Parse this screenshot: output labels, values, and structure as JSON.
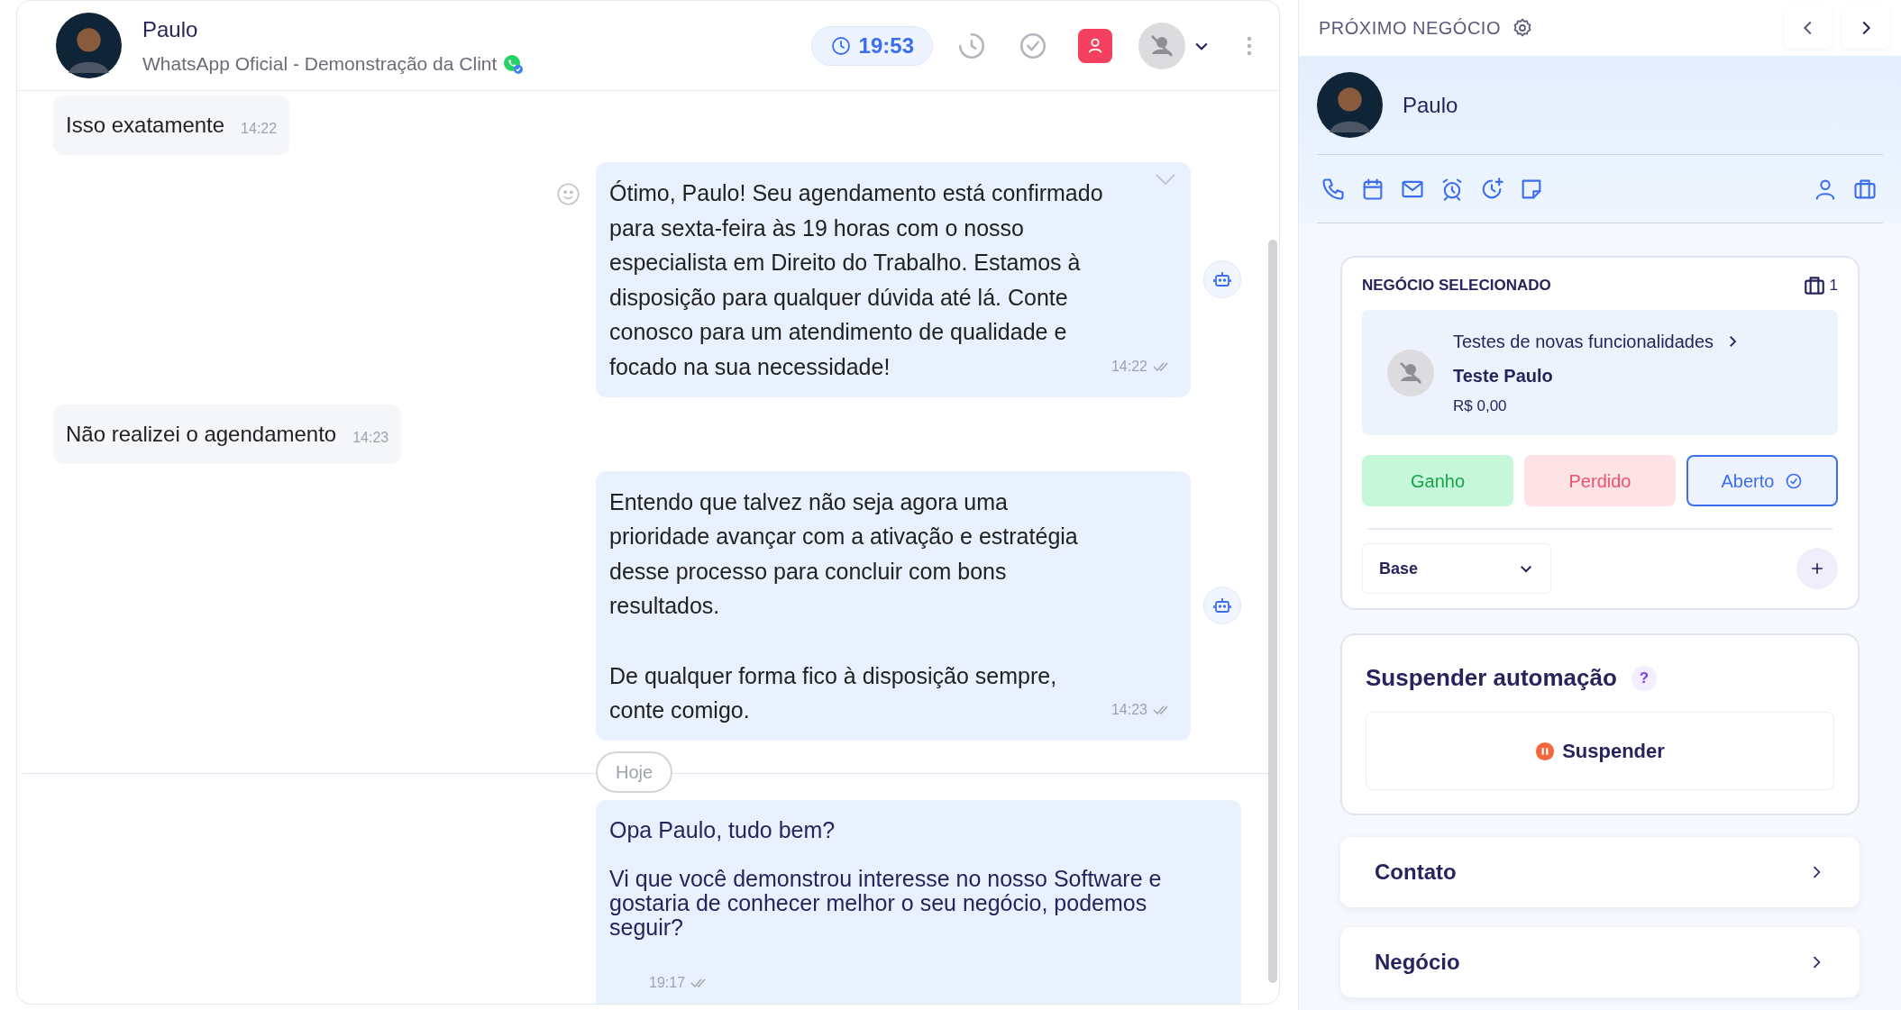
{
  "chat": {
    "contact": {
      "name": "Paulo",
      "channel": "WhatsApp Oficial - Demonstração da Clint"
    },
    "timer": "19:53",
    "messages": [
      {
        "kind": "incoming",
        "text": "Isso exatamente",
        "time": "14:22"
      },
      {
        "kind": "outgoing",
        "text": "Ótimo, Paulo! Seu agendamento está confirmado para sexta-feira às 19 horas com o nosso especialista em Direito do Trabalho. Estamos à disposição para qualquer dúvida até lá. Conte conosco para um atendimento de qualidade e focado na sua necessidade!",
        "time": "14:22",
        "automated": true,
        "hovered": true
      },
      {
        "kind": "incoming",
        "text": "Não realizei o agendamento",
        "time": "14:23"
      },
      {
        "kind": "outgoing",
        "text": "Entendo que talvez não seja agora uma prioridade avançar com a ativação e estratégia desse processo para concluir com bons resultados.\n\nDe qualquer forma fico à disposição sempre, conte comigo.",
        "time": "14:23",
        "automated": true,
        "hovered": false
      },
      {
        "kind": "date",
        "text": "Hoje"
      },
      {
        "kind": "outgoing",
        "text": "Opa Paulo, tudo bem?\n\nVi que você demonstrou interesse no nosso Software e gostaria de conhecer melhor o seu negócio, podemos seguir?",
        "time": "19:17",
        "automated": false,
        "hovered": false
      }
    ]
  },
  "side_panel": {
    "title": "PRÓXIMO NEGÓCIO",
    "contact_name": "Paulo",
    "selected_deal": {
      "title": "NEGÓCIO SELECIONADO",
      "count": "1",
      "pipeline": "Testes de novas funcionalidades",
      "name": "Teste Paulo",
      "value": "R$ 0,00",
      "statuses": [
        {
          "kind": "won",
          "label": "Ganho",
          "selected": false
        },
        {
          "kind": "lost",
          "label": "Perdido",
          "selected": false
        },
        {
          "kind": "open",
          "label": "Aberto",
          "selected": true
        }
      ],
      "stage": "Base"
    },
    "automation": {
      "title": "Suspender automação",
      "help": "?",
      "button": "Suspender"
    },
    "sections": [
      "Contato",
      "Negócio"
    ]
  }
}
